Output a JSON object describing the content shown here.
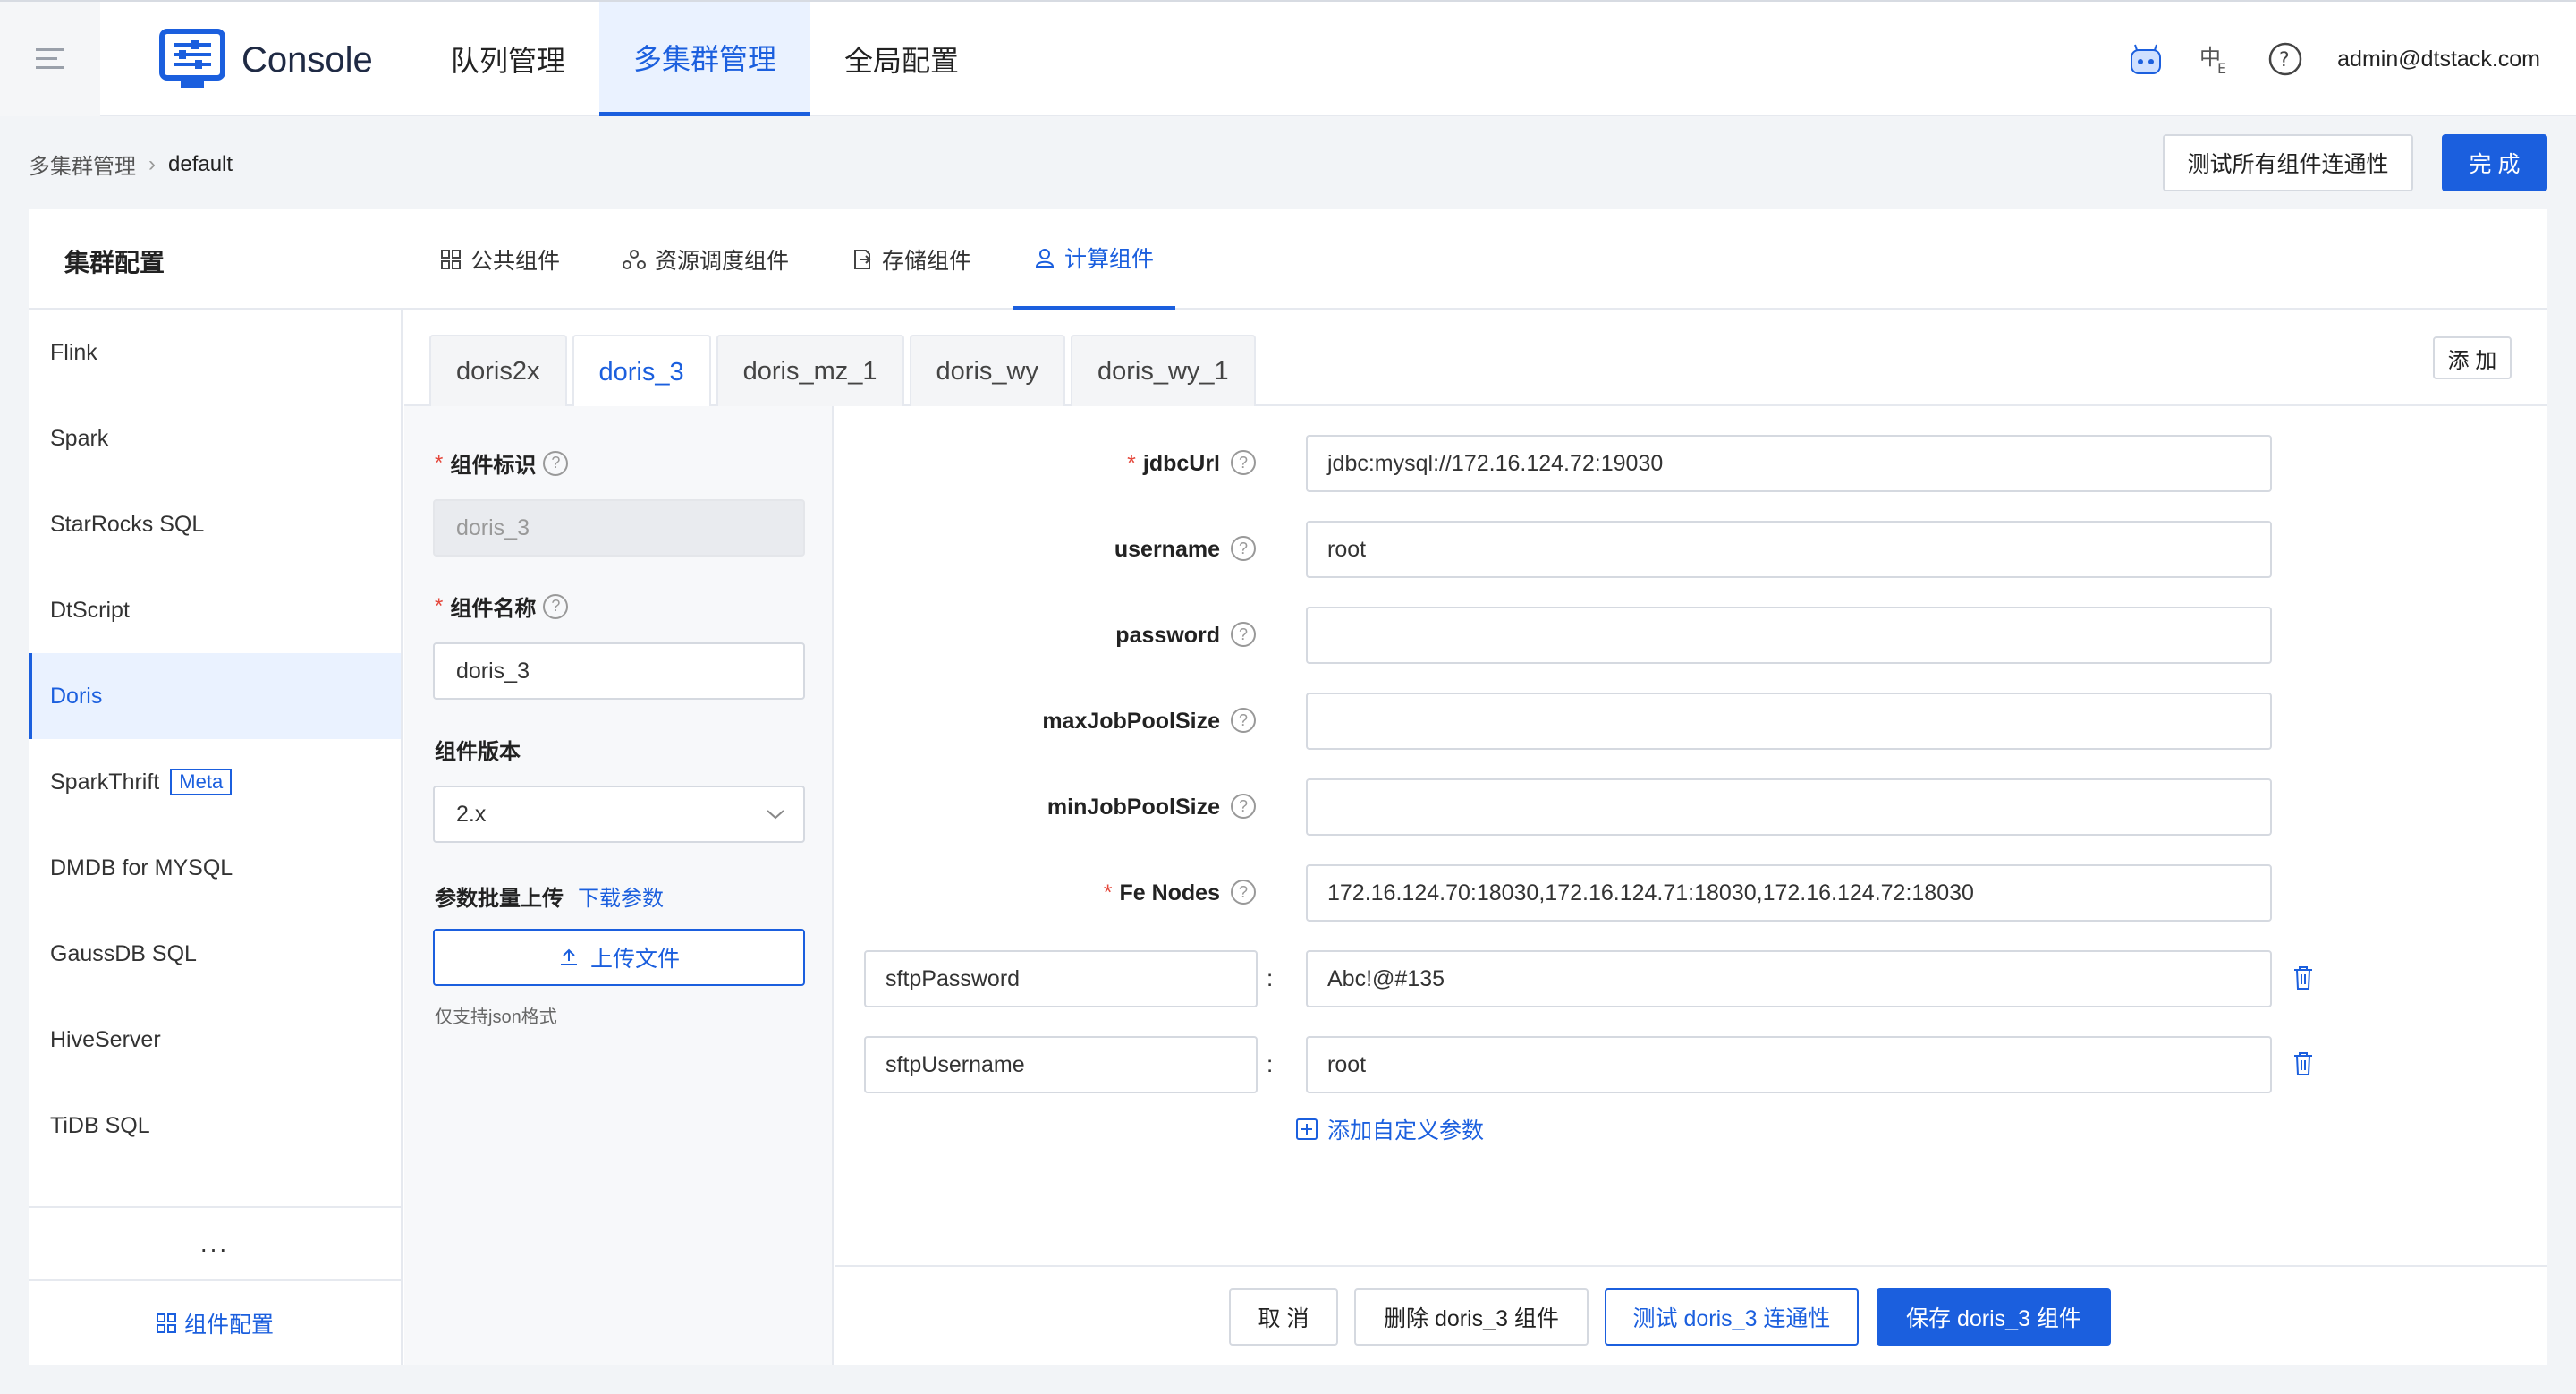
{
  "header": {
    "logo_text": "Console",
    "nav": [
      "队列管理",
      "多集群管理",
      "全局配置"
    ],
    "active_nav": 1,
    "user": "admin@dtstack.com"
  },
  "breadcrumb": {
    "root": "多集群管理",
    "current": "default"
  },
  "actions": {
    "test_all": "测试所有组件连通性",
    "done": "完 成"
  },
  "panel": {
    "title": "集群配置",
    "comp_tabs": [
      "公共组件",
      "资源调度组件",
      "存储组件",
      "计算组件"
    ],
    "active_comp_tab": 3
  },
  "sidebar": {
    "items": [
      "Flink",
      "Spark",
      "StarRocks SQL",
      "DtScript",
      "Doris",
      "SparkThrift",
      "DMDB for MYSQL",
      "GaussDB SQL",
      "HiveServer",
      "TiDB SQL"
    ],
    "active": 4,
    "meta_badge": "Meta",
    "more": "...",
    "footer": "组件配置"
  },
  "version_tabs": [
    "doris2x",
    "doris_3",
    "doris_mz_1",
    "doris_wy",
    "doris_wy_1"
  ],
  "active_version_tab": 1,
  "add_label": "添 加",
  "left_form": {
    "id_label": "组件标识",
    "id_value": "doris_3",
    "name_label": "组件名称",
    "name_value": "doris_3",
    "version_label": "组件版本",
    "version_value": "2.x",
    "batch_label": "参数批量上传",
    "download_link": "下载参数",
    "upload_label": "上传文件",
    "hint": "仅支持json格式"
  },
  "params": [
    {
      "key": "jdbcUrl",
      "required": true,
      "value": "jdbc:mysql://172.16.124.72:19030"
    },
    {
      "key": "username",
      "required": false,
      "value": "root"
    },
    {
      "key": "password",
      "required": false,
      "value": ""
    },
    {
      "key": "maxJobPoolSize",
      "required": false,
      "value": ""
    },
    {
      "key": "minJobPoolSize",
      "required": false,
      "value": ""
    },
    {
      "key": "Fe Nodes",
      "required": true,
      "value": "172.16.124.70:18030,172.16.124.71:18030,172.16.124.72:18030"
    }
  ],
  "custom_params": [
    {
      "key": "sftpPassword",
      "value": "Abc!@#135"
    },
    {
      "key": "sftpUsername",
      "value": "root"
    }
  ],
  "add_custom_param": "添加自定义参数",
  "footer": {
    "cancel": "取 消",
    "delete": "删除 doris_3 组件",
    "test": "测试 doris_3 连通性",
    "save": "保存 doris_3 组件"
  },
  "colors": {
    "primary": "#1b5fde",
    "required": "#e5483c"
  }
}
